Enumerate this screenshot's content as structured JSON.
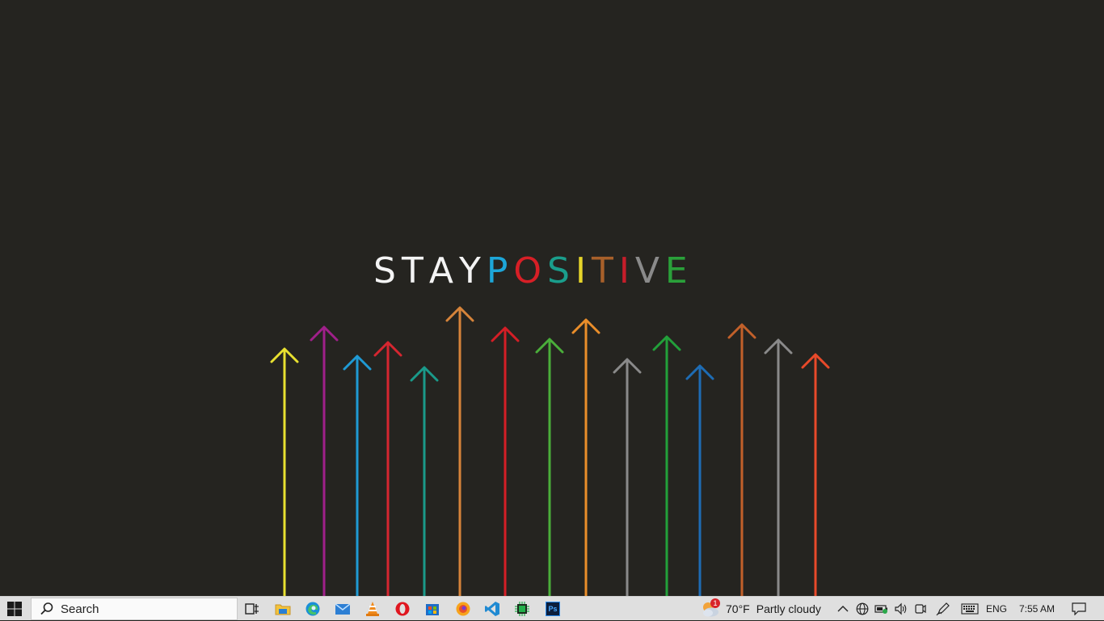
{
  "wallpaper": {
    "title_letters": [
      {
        "char": "S",
        "color": "#f4f4f4"
      },
      {
        "char": "T",
        "color": "#f4f4f4"
      },
      {
        "char": "A",
        "color": "#f4f4f4"
      },
      {
        "char": "Y",
        "color": "#f4f4f4"
      },
      {
        "char": "P",
        "color": "#1da6d8"
      },
      {
        "char": "O",
        "color": "#d71f26"
      },
      {
        "char": "S",
        "color": "#1a9e8c"
      },
      {
        "char": "I",
        "color": "#e6d52a"
      },
      {
        "char": "T",
        "color": "#a8602a"
      },
      {
        "char": "I",
        "color": "#c61d2a"
      },
      {
        "char": "V",
        "color": "#8a8a8a"
      },
      {
        "char": "E",
        "color": "#2aa03a"
      }
    ],
    "arrows": [
      {
        "color": "#e8e030"
      },
      {
        "color": "#a0208a"
      },
      {
        "color": "#1f9ad4"
      },
      {
        "color": "#d62630"
      },
      {
        "color": "#1a9a8a"
      },
      {
        "color": "#d6843a"
      },
      {
        "color": "#d41e26"
      },
      {
        "color": "#4aae3a"
      },
      {
        "color": "#ea8e2a"
      },
      {
        "color": "#8a8a8a"
      },
      {
        "color": "#22a03a"
      },
      {
        "color": "#1e6cb4"
      },
      {
        "color": "#c2602a"
      },
      {
        "color": "#8a8a8a"
      },
      {
        "color": "#e84a2a"
      }
    ]
  },
  "taskbar": {
    "start_icon": "windows-logo-icon",
    "search": {
      "placeholder": "Search"
    },
    "pinned": [
      {
        "name": "task-view-icon"
      },
      {
        "name": "file-explorer-icon"
      },
      {
        "name": "edge-icon"
      },
      {
        "name": "mail-icon"
      },
      {
        "name": "vlc-icon"
      },
      {
        "name": "opera-icon"
      },
      {
        "name": "store-icon"
      },
      {
        "name": "firefox-icon"
      },
      {
        "name": "vscode-icon"
      },
      {
        "name": "chip-app-icon"
      },
      {
        "name": "photoshop-icon",
        "label": "Ps"
      }
    ],
    "weather": {
      "temp": "70°F",
      "condition": "Partly cloudy",
      "badge": "1"
    },
    "tray": [
      "chevron-up-icon",
      "globe-icon",
      "battery-icon",
      "volume-icon",
      "meet-now-icon",
      "pen-icon",
      "keyboard-icon"
    ],
    "language": "ENG",
    "time": "7:55 AM",
    "colors": {
      "taskbar_bg": "#dfdfdf",
      "accent_blue": "#0a74da"
    }
  }
}
